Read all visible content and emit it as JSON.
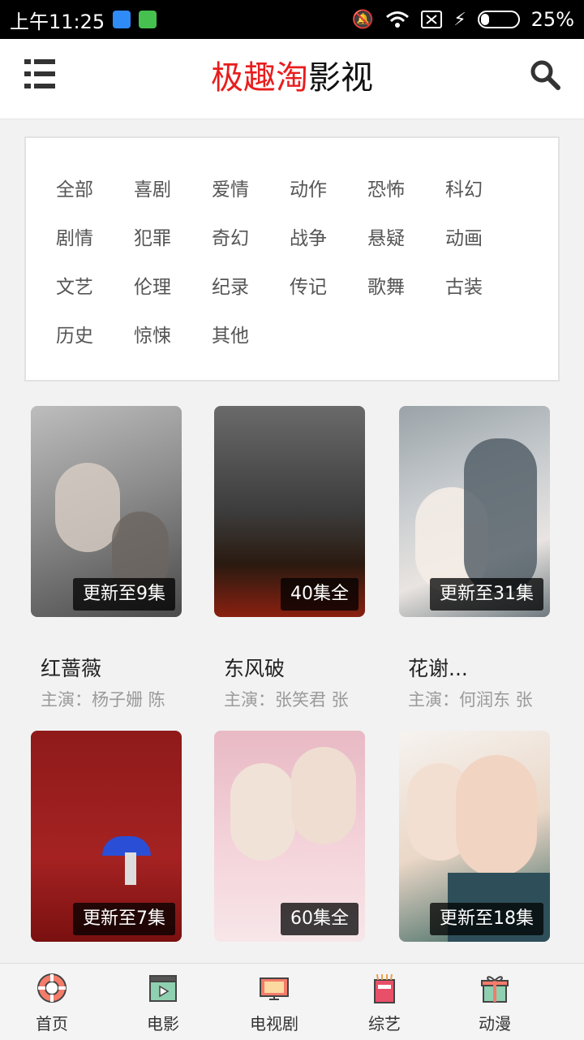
{
  "status_bar": {
    "time": "上午11:25",
    "battery_percent": "25%"
  },
  "header": {
    "title_red": "极趣淘",
    "title_black": "影视"
  },
  "categories": [
    "全部",
    "喜剧",
    "爱情",
    "动作",
    "恐怖",
    "科幻",
    "剧情",
    "犯罪",
    "奇幻",
    "战争",
    "悬疑",
    "动画",
    "文艺",
    "伦理",
    "纪录",
    "传记",
    "歌舞",
    "古装",
    "历史",
    "惊悚",
    "其他"
  ],
  "shows": [
    {
      "title": "红蔷薇",
      "cast": "主演：杨子姗 陈",
      "badge": "更新至9集"
    },
    {
      "title": "东风破",
      "cast": "主演：张笑君 张",
      "badge": "40集全"
    },
    {
      "title": "花谢...",
      "cast": "主演：何润东 张",
      "badge": "更新至31集"
    },
    {
      "title": "",
      "cast": "",
      "badge": "更新至7集"
    },
    {
      "title": "",
      "cast": "",
      "badge": "60集全"
    },
    {
      "title": "",
      "cast": "",
      "badge": "更新至18集"
    }
  ],
  "bottom_nav": [
    {
      "label": "首页",
      "icon": "home-lifebuoy-icon"
    },
    {
      "label": "电影",
      "icon": "clapperboard-icon"
    },
    {
      "label": "电视剧",
      "icon": "tv-icon"
    },
    {
      "label": "综艺",
      "icon": "variety-box-icon"
    },
    {
      "label": "动漫",
      "icon": "gift-icon"
    }
  ],
  "colors": {
    "accent_red": "#e81d1d",
    "status_bar_bg": "#000000",
    "badge_bg": "rgba(0,0,0,0.75)"
  }
}
